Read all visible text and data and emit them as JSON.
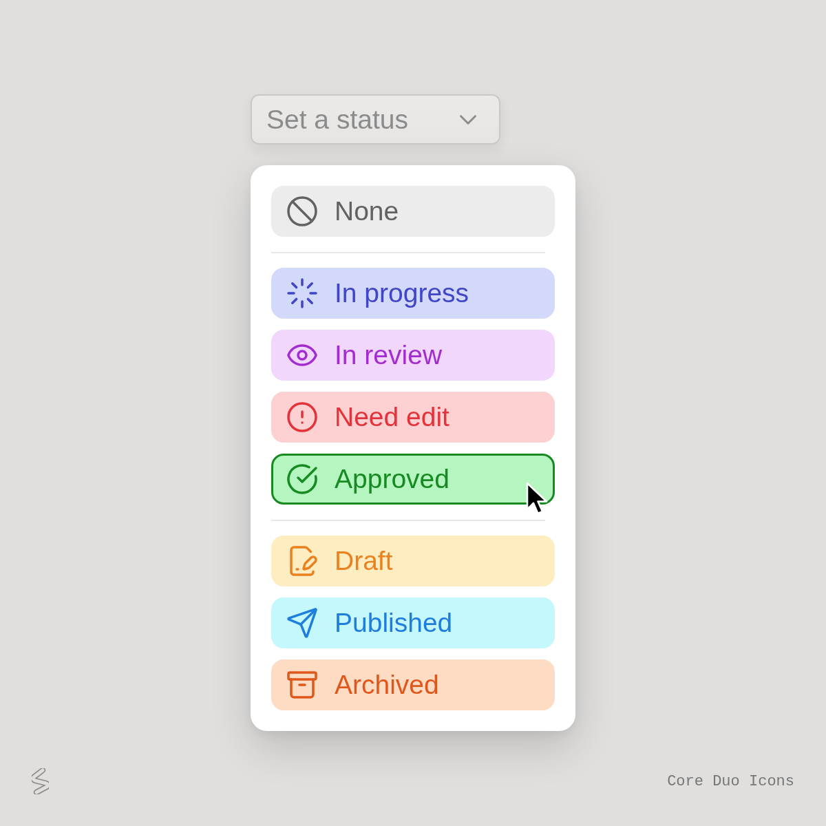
{
  "status_select": {
    "placeholder": "Set a status"
  },
  "menu": {
    "groups": [
      {
        "items": [
          {
            "kind": "none",
            "label": "None",
            "color": "#626262",
            "selected": false
          }
        ]
      },
      {
        "items": [
          {
            "kind": "progress",
            "label": "In progress",
            "color": "#4046c6",
            "selected": false
          },
          {
            "kind": "review",
            "label": "In review",
            "color": "#a22ccf",
            "selected": false
          },
          {
            "kind": "edit",
            "label": "Need edit",
            "color": "#e3323a",
            "selected": false
          },
          {
            "kind": "approved",
            "label": "Approved",
            "color": "#178a21",
            "selected": true
          }
        ]
      },
      {
        "items": [
          {
            "kind": "draft",
            "label": "Draft",
            "color": "#eb801f",
            "selected": false
          },
          {
            "kind": "published",
            "label": "Published",
            "color": "#1f7edd",
            "selected": false
          },
          {
            "kind": "archived",
            "label": "Archived",
            "color": "#df571b",
            "selected": false
          }
        ]
      }
    ]
  },
  "footer": {
    "caption": "Core Duo Icons"
  }
}
